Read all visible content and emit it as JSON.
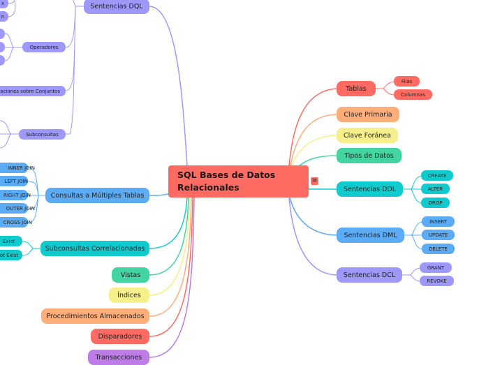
{
  "root": {
    "title": "SQL Bases de Datos Relacionales",
    "menu_icon": "≡"
  },
  "colors": {
    "red": "#ff6b62",
    "orange": "#ffae7a",
    "yellow": "#f7f08a",
    "green": "#43d5a1",
    "teal": "#0fcbcd",
    "blue": "#5cacf5",
    "purple": "#9e98fb",
    "violet": "#bd7ce6"
  },
  "right": {
    "tablas": {
      "label": "Tablas",
      "children": [
        "Filas",
        "Columnas"
      ]
    },
    "clave_primaria": {
      "label": "Clave Primaria"
    },
    "clave_foranea": {
      "label": "Clave Foránea"
    },
    "tipos_datos": {
      "label": "Tipos de Datos"
    },
    "ddl": {
      "label": "Sentencias DDL",
      "children": [
        "CREATE",
        "ALTER",
        "DROP"
      ]
    },
    "dml": {
      "label": "Sentencias DML",
      "children": [
        "INSERT",
        "UPDATE",
        "DELETE"
      ]
    },
    "dcl": {
      "label": "Sentencias DCL",
      "children": [
        "GRANT",
        "REVOKE"
      ]
    }
  },
  "left": {
    "dql": {
      "label": "Sentencias DQL",
      "children": {
        "top_partial": [
          "x",
          "n"
        ],
        "operadores": {
          "label": "Operadores"
        },
        "conjuntos": {
          "label": "Operaciones sobre Conjuntos"
        },
        "subconsultas": {
          "label": "Subconsultas"
        }
      }
    },
    "multiples": {
      "label": "Consultas a Múltiples Tablas",
      "children": [
        "INNER JOIN",
        "LEFT JOIN",
        "RIGHT JOIN",
        "OUTER JOIN",
        "CROSS JOIN"
      ]
    },
    "correlacionadas": {
      "label": "Subconsultas Correlacionadas",
      "children": [
        "Exist",
        "Not Exist"
      ]
    },
    "vistas": {
      "label": "Vistas"
    },
    "indices": {
      "label": "Índices"
    },
    "procedimientos": {
      "label": "Procedimientos Almacenados"
    },
    "disparadores": {
      "label": "Disparadores"
    },
    "transacciones": {
      "label": "Transacciones"
    }
  }
}
